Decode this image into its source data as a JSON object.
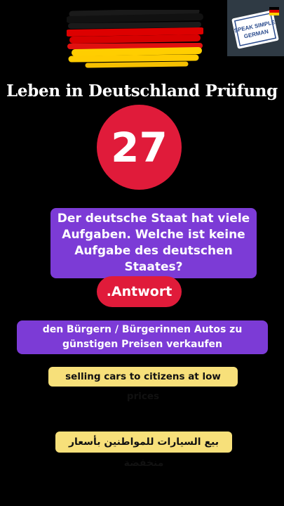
{
  "header": {
    "title": "Leben in Deutschland Prüfung",
    "logo_text": [
      "SPEAK SIMPLE",
      "GERMAN"
    ]
  },
  "question": {
    "number": "27",
    "text": "Der deutsche Staat hat viele Aufgaben. Welche ist keine Aufgabe des deutschen Staates?"
  },
  "answer": {
    "label": ".Antwort",
    "german": "den Bürgern / Bürgerinnen Autos zu günstigen Preisen verkaufen",
    "english": "selling cars to citizens at low prices",
    "arabic": "بيع السيارات للمواطنين بأسعار منخفضة"
  },
  "colors": {
    "background": "#000000",
    "accent_red": "#e01b3a",
    "purple": "#7c3bd6",
    "yellow": "#f7e07a",
    "flag": [
      "#000000",
      "#dd0000",
      "#ffce00"
    ]
  },
  "icons": {
    "logo": "speak-simple-german-logo-icon",
    "flag": "german-flag-icon"
  }
}
